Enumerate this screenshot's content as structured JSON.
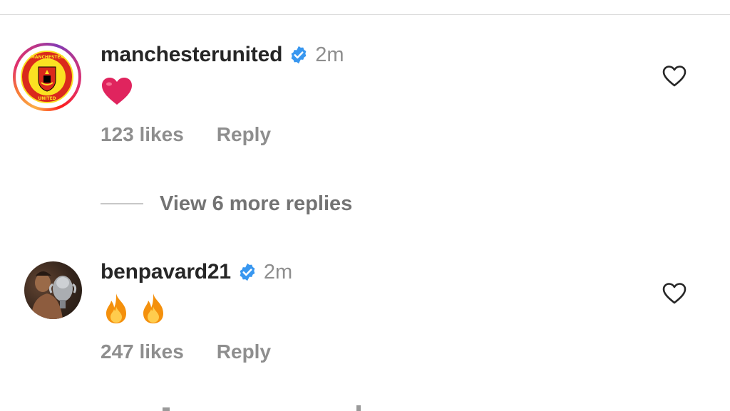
{
  "comments": [
    {
      "username": "manchesterunited",
      "verified": true,
      "time": "2m",
      "emojis": [
        "heart"
      ],
      "likes": "123 likes",
      "reply_label": "Reply",
      "avatar": "manchester-united-crest-icon"
    },
    {
      "username": "benpavard21",
      "verified": true,
      "time": "2m",
      "emojis": [
        "fire",
        "fire"
      ],
      "likes": "247 likes",
      "reply_label": "Reply",
      "avatar": "profile-photo"
    }
  ],
  "view_replies": {
    "label": "View 6 more replies"
  },
  "colors": {
    "text_primary": "#262626",
    "text_secondary": "#8e8e8e",
    "verified_blue": "#3897f0",
    "heart_red": "#e0245e",
    "divider": "#dbdbdb"
  }
}
